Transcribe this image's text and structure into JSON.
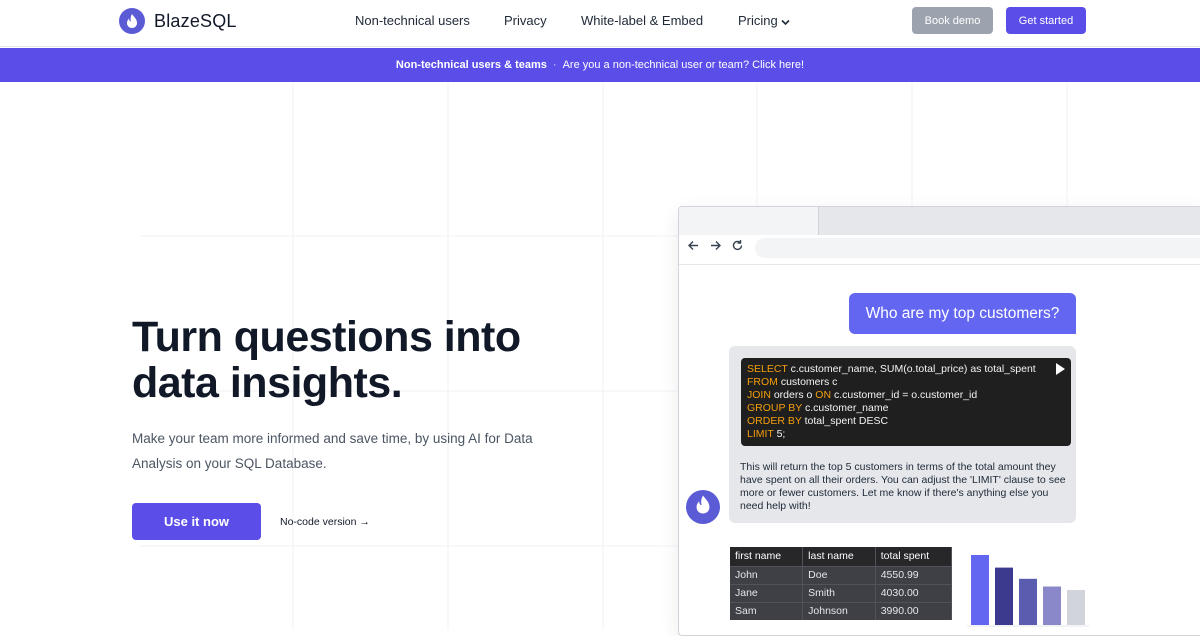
{
  "nav": {
    "brand": "BlazeSQL",
    "links": [
      "Non-technical users",
      "Privacy",
      "White-label & Embed",
      "Pricing"
    ],
    "book_demo": "Book demo",
    "get_started": "Get started"
  },
  "banner": {
    "strong": "Non-technical users & teams",
    "separator": "·",
    "text": "Are you a non-technical user or team? Click here!"
  },
  "hero": {
    "title_line1": "Turn questions into",
    "title_line2": "data insights.",
    "subtitle": "Make your team more informed and save time, by using AI for Data Analysis on your SQL Database.",
    "cta": "Use it now",
    "secondary": "No-code version →"
  },
  "demo": {
    "question": "Who are my top customers?",
    "code": [
      {
        "kw": "SELECT",
        "rest": " c.customer_name, SUM(o.total_price) as total_spent"
      },
      {
        "kw": "FROM",
        "rest": " customers c"
      },
      {
        "kw": "JOIN",
        "rest": " orders o ",
        "kw2": "ON",
        "rest2": " c.customer_id = o.customer_id"
      },
      {
        "kw": "GROUP BY",
        "rest": " c.customer_name"
      },
      {
        "kw": "ORDER BY",
        "rest": " total_spent DESC"
      },
      {
        "kw": "LIMIT",
        "rest": " 5;"
      }
    ],
    "answer": "This will return the top 5 customers in terms of the total amount they have spent on all their orders. You can adjust the 'LIMIT' clause to see more or fewer customers. Let me know if there's anything else you need help with!",
    "table": {
      "headers": [
        "first name",
        "last name",
        "total spent"
      ],
      "rows": [
        [
          "John",
          "Doe",
          "4550.99"
        ],
        [
          "Jane",
          "Smith",
          "4030.00"
        ],
        [
          "Sam",
          "Johnson",
          "3990.00"
        ]
      ]
    },
    "chart_bars": [
      {
        "value": 1.0,
        "color": "#6366f1"
      },
      {
        "value": 0.82,
        "color": "#3b3a8f"
      },
      {
        "value": 0.66,
        "color": "#5b5bb0"
      },
      {
        "value": 0.55,
        "color": "#8b88c9"
      },
      {
        "value": 0.5,
        "color": "#d1d5db"
      }
    ]
  },
  "colors": {
    "accent": "#5b4de8",
    "bubble": "#6366f1",
    "code_keyword": "#f59e0b"
  }
}
